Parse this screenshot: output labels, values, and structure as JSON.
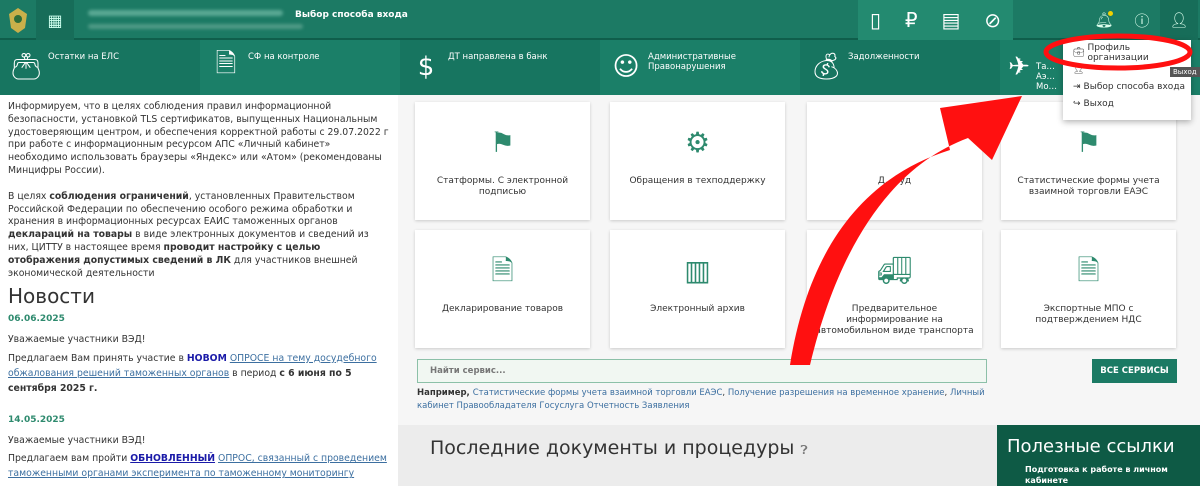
{
  "header": {
    "login_mode": "Выбор способа входа",
    "quick_icons": [
      "passport-icon",
      "ruble-icon",
      "spreadsheet-icon",
      "barrier-location-icon"
    ]
  },
  "nav": [
    {
      "label": "Остатки на ЕЛС",
      "icon": "purse-icon"
    },
    {
      "label": "СФ на контроле",
      "icon": "document-icon"
    },
    {
      "label": "ДТ направлена в банк",
      "icon": "coins-icon"
    },
    {
      "label": "Административные Правонарушения",
      "icon": "officer-icon"
    },
    {
      "label": "Задолженности",
      "icon": "money-bag-icon"
    },
    {
      "label": "Та… Аэ… Мо…",
      "icon": "plane-icon"
    }
  ],
  "user_menu": {
    "items": [
      "Профиль организации",
      "Выбор способа входа",
      "Выход"
    ],
    "tooltip": "Выход"
  },
  "info": {
    "p1": "Информируем, что в целях соблюдения правил  информационной безопасности, установкой TLS сертификатов, выпущенных Национальным удостоверяющим центром, и обеспечения корректной работы с 29.07.2022 г при работе с информационным ресурсом АПС «Личный кабинет» необходимо использовать браузеры «Яндекс» или «Атом» (рекомендованы Минцифры России).",
    "p2a": "В целях ",
    "p2b": "соблюдения ограничений",
    "p2c": ", установленных Правительством Российской Федерации по обеспечению особого режима обработки и хранения в информационных ресурсах ЕАИС таможенных органов ",
    "p2d": "деклараций на товары",
    "p2e": " в виде электронных документов и сведений из них, ЦИТТУ в настоящее время ",
    "p2f": "проводит настройку с целью отображения допустимых  сведений в  ЛК",
    "p2g": " для участников внешней экономической деятельности"
  },
  "news": {
    "title": "Новости",
    "items": [
      {
        "date": "06.06.2025",
        "greeting": "Уважаемые участники ВЭД!",
        "t1": "Предлагаем Вам принять участие в ",
        "t2": "НОВОМ",
        "t3": " ",
        "link": "ОПРОСЕ на тему досудебного обжалования решений таможенных органов",
        "t4": "  в период ",
        "t5": "с 6 июня по 5 сентября 2025 г."
      },
      {
        "date": "14.05.2025",
        "greeting": "Уважаемые участники ВЭД!",
        "t1": "Предлагаем вам пройти  ",
        "t2": "ОБНОВЛЕННЫЙ",
        "t3": " ",
        "link": "ОПРОС, связанный с проведением таможенными органами эксперимента по таможенному мониторингу"
      }
    ]
  },
  "services": [
    {
      "label": "Статформы. С электронной подписью",
      "icon": "eaeu-flags-icon"
    },
    {
      "label": "Обращения в техподдержку",
      "icon": "support-icon"
    },
    {
      "label": "Д…руд",
      "icon": "hidden-icon"
    },
    {
      "label": "Статистические формы учета взаимной торговли ЕАЭС",
      "icon": "eaeu-flags-icon"
    },
    {
      "label": "Декларирование товаров",
      "icon": "dt-file-icon"
    },
    {
      "label": "Электронный архив",
      "icon": "archive-icon"
    },
    {
      "label": "Предварительное информирование на автомобильном виде транспорта",
      "icon": "truck-doc-icon"
    },
    {
      "label": "Экспортные МПО с подтверждением НДС",
      "icon": "mpo-file-icon"
    }
  ],
  "search": {
    "placeholder": "Найти сервис...",
    "button": "ВСЕ СЕРВИСЫ",
    "examples_label": "Например, ",
    "examples": [
      "Статистические формы учета взаимной торговли ЕАЭС",
      "Получение разрешения на временное хранение",
      "Личный кабинет Правообладателя",
      "Госуслуга Отчетность",
      "Заявления"
    ]
  },
  "recent": {
    "title": "Последние документы и процедуры"
  },
  "useful": {
    "title": "Полезные ссылки",
    "items": [
      "Подготовка к работе в личном кабинете"
    ]
  },
  "colors": {
    "brand": "#1c7a64",
    "annotation": "#ff1010"
  }
}
